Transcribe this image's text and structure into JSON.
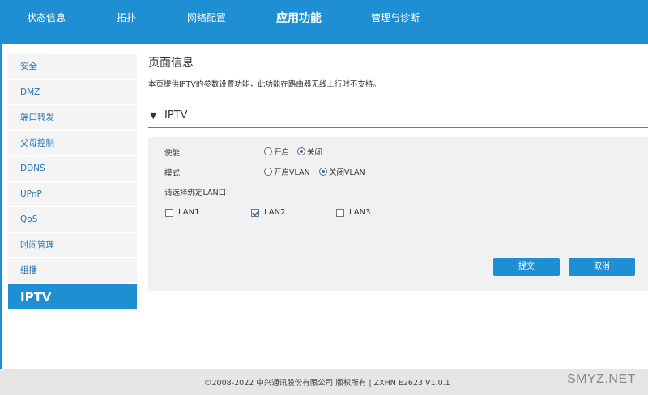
{
  "topnav": {
    "items": [
      {
        "label": "状态信息"
      },
      {
        "label": "拓扑"
      },
      {
        "label": "网络配置"
      },
      {
        "label": "应用功能",
        "active": true
      },
      {
        "label": "管理与诊断"
      }
    ]
  },
  "sidebar": {
    "items": [
      {
        "label": "安全"
      },
      {
        "label": "DMZ"
      },
      {
        "label": "端口转发"
      },
      {
        "label": "父母控制"
      },
      {
        "label": "DDNS"
      },
      {
        "label": "UPnP"
      },
      {
        "label": "QoS"
      },
      {
        "label": "时间管理"
      },
      {
        "label": "组播"
      },
      {
        "label": "IPTV",
        "active": true
      }
    ]
  },
  "page": {
    "title": "页面信息",
    "description": "本页提供IPTV的参数设置功能，此功能在路由器无线上行时不支持。"
  },
  "section": {
    "arrow": "▼",
    "label": "IPTV"
  },
  "form": {
    "enable": {
      "label": "使能",
      "options": [
        {
          "label": "开启",
          "selected": false
        },
        {
          "label": "关闭",
          "selected": true
        }
      ]
    },
    "mode": {
      "label": "模式",
      "options": [
        {
          "label": "开启VLAN",
          "selected": false
        },
        {
          "label": "关闭VLAN",
          "selected": true
        }
      ]
    },
    "lan_select": {
      "label": "请选择绑定LAN口：",
      "ports": [
        {
          "label": "LAN1",
          "checked": false
        },
        {
          "label": "LAN2",
          "checked": true
        },
        {
          "label": "LAN3",
          "checked": false
        }
      ]
    },
    "submit_label": "提交",
    "cancel_label": "取消"
  },
  "footer": {
    "text": "©2008-2022 中兴通讯股份有限公司 版权所有  |   ZXHN E2623 V1.0.1"
  },
  "watermark": "SMYZ.NET",
  "colors": {
    "accent": "#1e8fd2",
    "panel": "#f1f1f1",
    "footer": "#e6e6e6"
  }
}
